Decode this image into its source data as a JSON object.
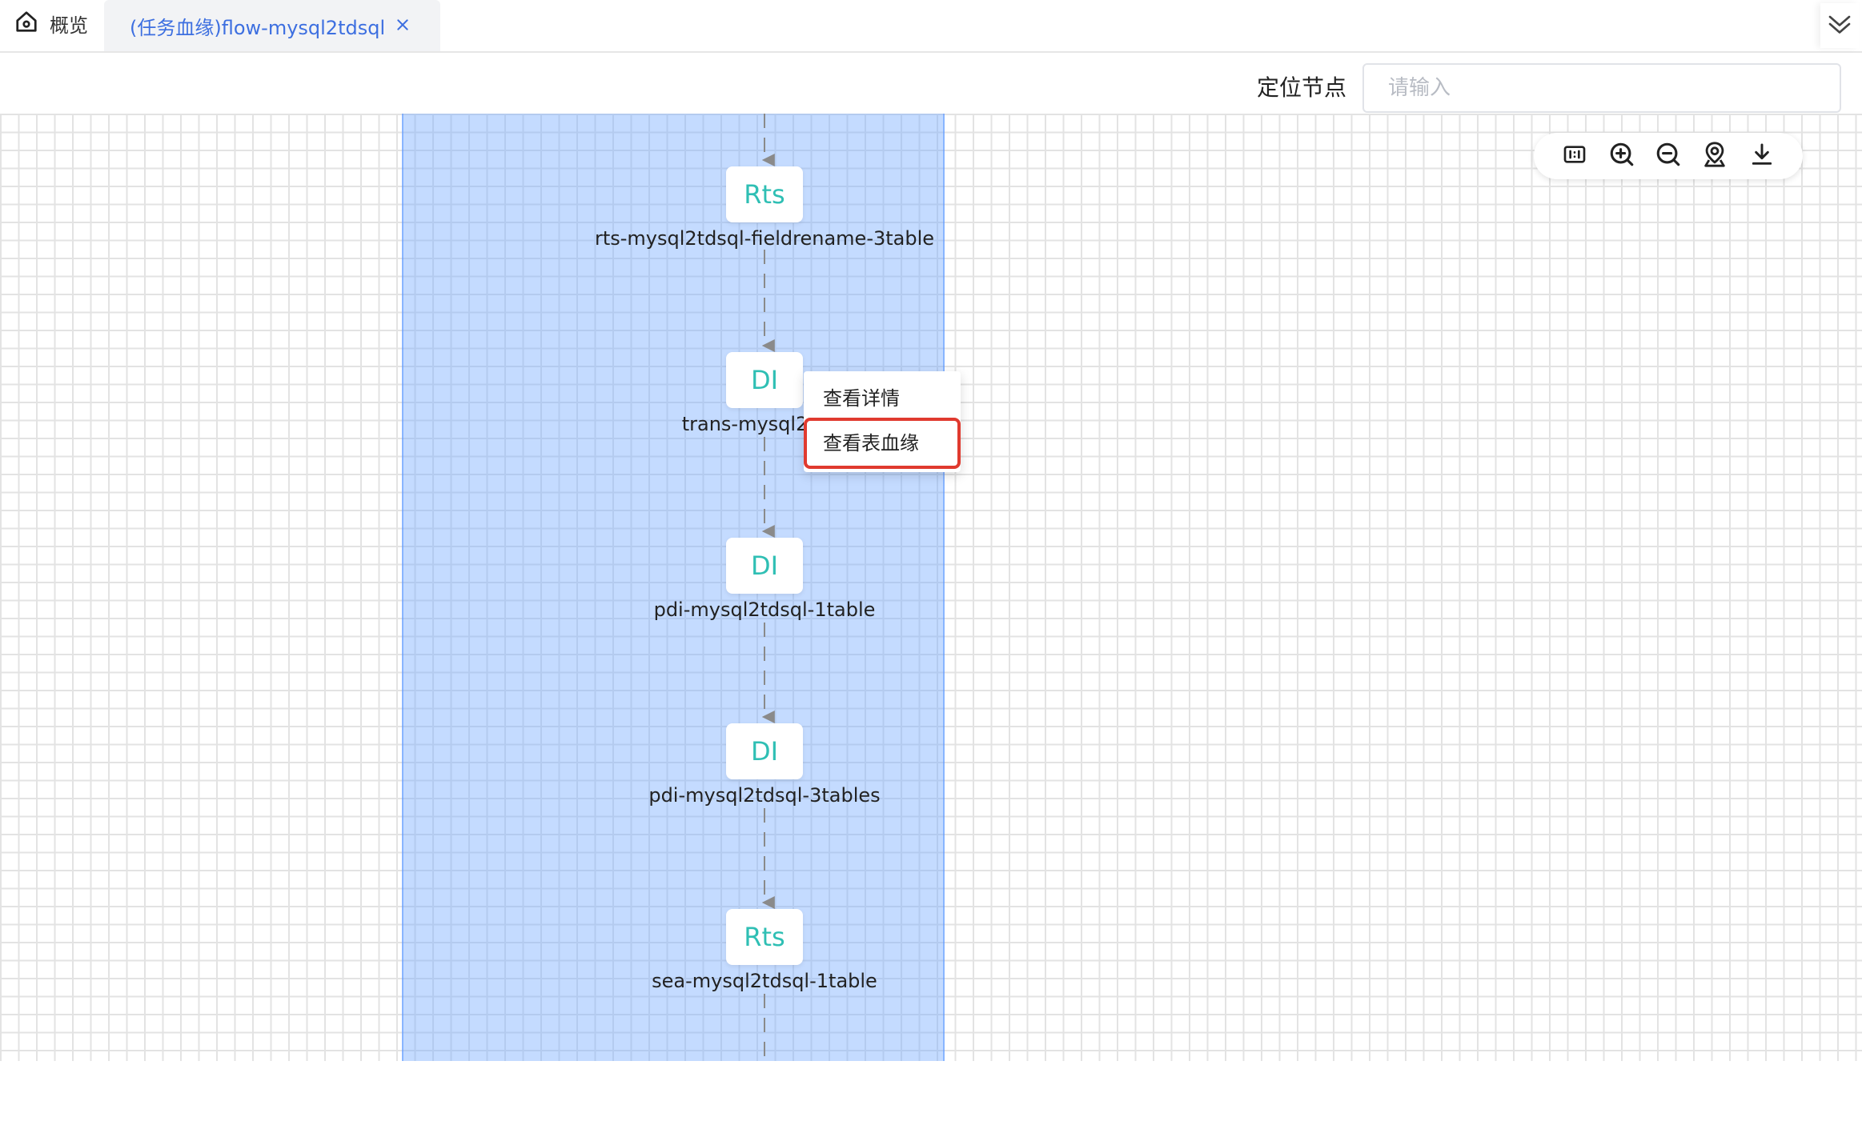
{
  "tabs": {
    "home": {
      "label": "概览",
      "icon": "home-icon"
    },
    "active": {
      "label": "(任务血缘)flow-mysql2tdsql",
      "close_icon": "close-icon"
    },
    "more_icon": "double-chevron-down-icon"
  },
  "locate": {
    "label": "定位节点",
    "placeholder": "请输入",
    "value": ""
  },
  "toolbar": {
    "icons": [
      "fit-view-icon",
      "zoom-in-icon",
      "zoom-out-icon",
      "locate-icon",
      "download-icon"
    ]
  },
  "nodes": [
    {
      "type": "Rts",
      "name": "rts-mysql2tdsql-fieldrename-3table"
    },
    {
      "type": "DI",
      "name": "trans-mysql2T"
    },
    {
      "type": "DI",
      "name": "pdi-mysql2tdsql-1table"
    },
    {
      "type": "DI",
      "name": "pdi-mysql2tdsql-3tables"
    },
    {
      "type": "Rts",
      "name": "sea-mysql2tdsql-1table"
    }
  ],
  "context_menu": {
    "items": [
      "查看详情",
      "查看表血缘"
    ]
  },
  "colors": {
    "accent": "#3d6fe0",
    "node_text": "#2fbfb4",
    "highlight_band": "#73aaff",
    "menu_highlight_border": "#e03a2f"
  }
}
